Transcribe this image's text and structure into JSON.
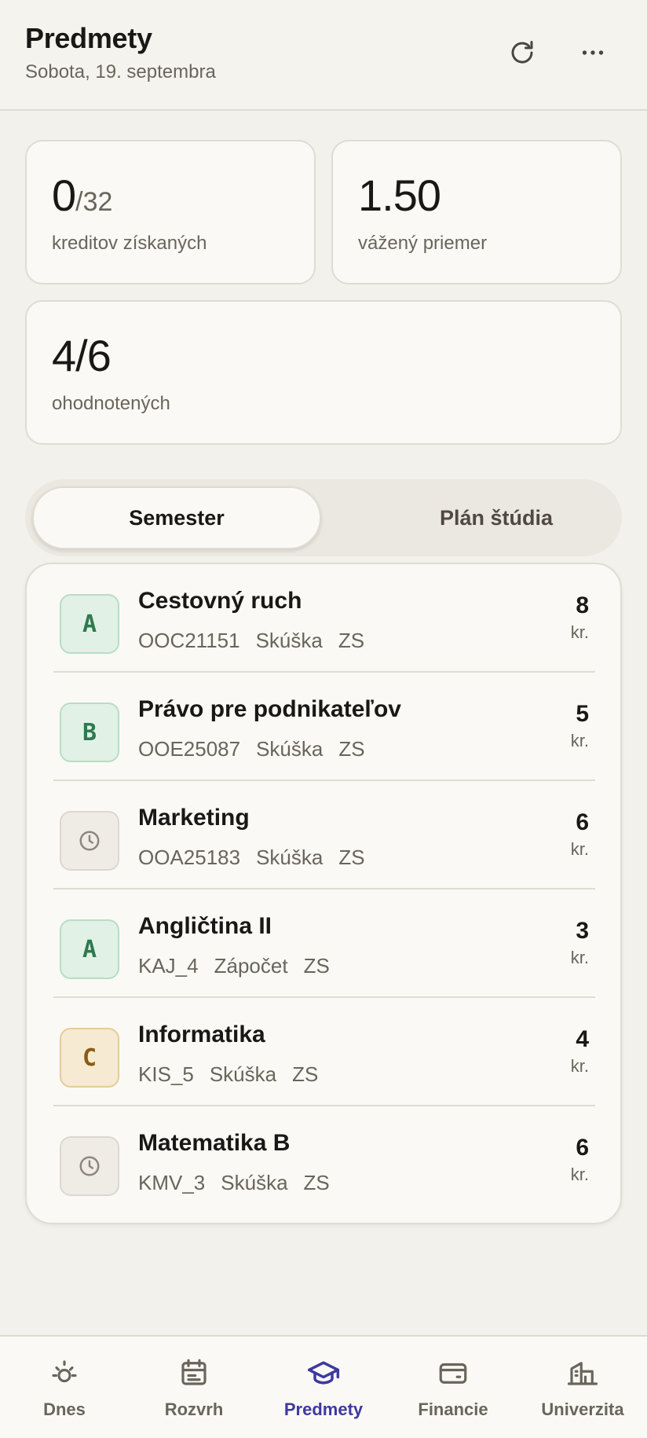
{
  "header": {
    "title": "Predmety",
    "date": "Sobota, 19. septembra",
    "refresh_icon": "refresh-icon",
    "more_icon": "more-horizontal-icon"
  },
  "stats": {
    "credits": {
      "earned": "0",
      "total": "/32",
      "label": "kreditov získaných"
    },
    "average": {
      "value": "1.50",
      "label": "vážený priemer"
    },
    "graded": {
      "value": "4/6",
      "label": "ohodnotených"
    }
  },
  "tabs": {
    "semester": "Semester",
    "plan": "Plán štúdia",
    "active": "semester"
  },
  "courses": [
    {
      "grade": "A",
      "grade_type": "green",
      "name": "Cestovný ruch",
      "code": "OOC21151",
      "type": "Skúška",
      "term": "ZS",
      "credits": "8",
      "unit": "kr."
    },
    {
      "grade": "B",
      "grade_type": "green",
      "name": "Právo pre podnikateľov",
      "code": "OOE25087",
      "type": "Skúška",
      "term": "ZS",
      "credits": "5",
      "unit": "kr."
    },
    {
      "grade": "",
      "grade_type": "pending",
      "name": "Marketing",
      "code": "OOA25183",
      "type": "Skúška",
      "term": "ZS",
      "credits": "6",
      "unit": "kr."
    },
    {
      "grade": "A",
      "grade_type": "green",
      "name": "Angličtina II",
      "code": "KAJ_4",
      "type": "Zápočet",
      "term": "ZS",
      "credits": "3",
      "unit": "kr."
    },
    {
      "grade": "C",
      "grade_type": "amber",
      "name": "Informatika",
      "code": "KIS_5",
      "type": "Skúška",
      "term": "ZS",
      "credits": "4",
      "unit": "kr."
    },
    {
      "grade": "",
      "grade_type": "pending",
      "name": "Matematika B",
      "code": "KMV_3",
      "type": "Skúška",
      "term": "ZS",
      "credits": "6",
      "unit": "kr."
    }
  ],
  "nav": {
    "items": [
      {
        "label": "Dnes",
        "icon": "sun-icon"
      },
      {
        "label": "Rozvrh",
        "icon": "calendar-icon"
      },
      {
        "label": "Predmety",
        "icon": "graduation-cap-icon"
      },
      {
        "label": "Financie",
        "icon": "wallet-icon"
      },
      {
        "label": "Univerzita",
        "icon": "building-icon"
      }
    ],
    "active": "Predmety",
    "active_color": "#3d39a0"
  }
}
